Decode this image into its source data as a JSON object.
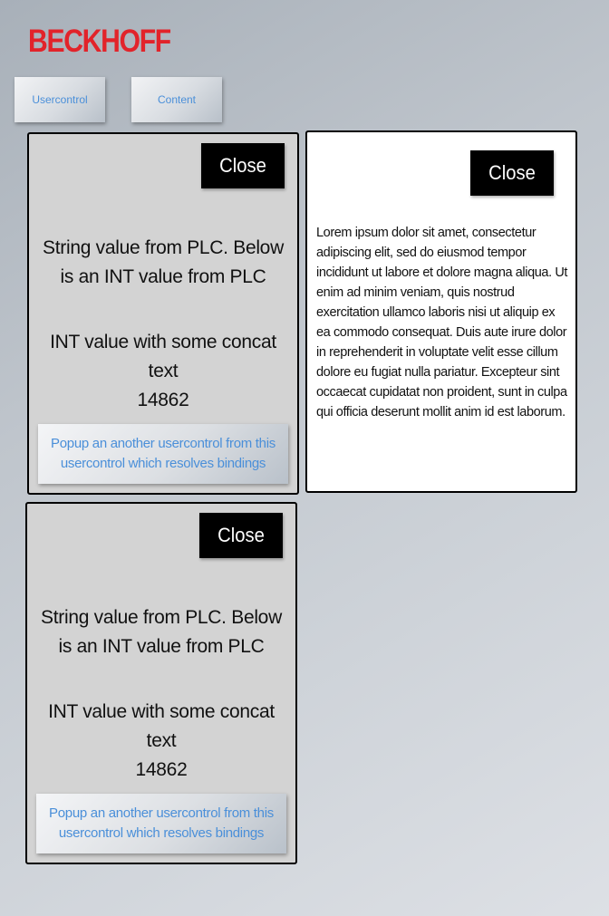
{
  "brand": {
    "logo_text": "BECKHOFF",
    "logo_color": "#e2232a"
  },
  "nav": {
    "usercontrol_label": "Usercontrol",
    "content_label": "Content"
  },
  "panel1": {
    "close_label": "Close",
    "string_value": "String value from PLC. Below is an INT value from PLC",
    "int_text": "INT value with some concat text",
    "int_value": "14862",
    "popup_label": "Popup an another usercontrol from this usercontrol which resolves bindings"
  },
  "content_panel": {
    "close_label": "Close",
    "body": "Lorem ipsum dolor sit amet, consectetur adipiscing elit, sed do eiusmod tempor incididunt ut labore et dolore magna aliqua. Ut enim ad minim veniam, quis nostrud exercitation ullamco laboris nisi ut aliquip ex ea commodo consequat. Duis aute irure dolor in reprehenderit in voluptate velit esse cillum dolore eu fugiat nulla pariatur. Excepteur sint occaecat cupidatat non proident, sunt in culpa qui officia deserunt mollit anim id est laborum."
  },
  "panel2": {
    "close_label": "Close",
    "string_value": "String value from PLC. Below is an INT value from PLC",
    "int_text": "INT value with some concat text",
    "int_value": "14862",
    "popup_label": "Popup an another usercontrol from this usercontrol which resolves bindings"
  }
}
